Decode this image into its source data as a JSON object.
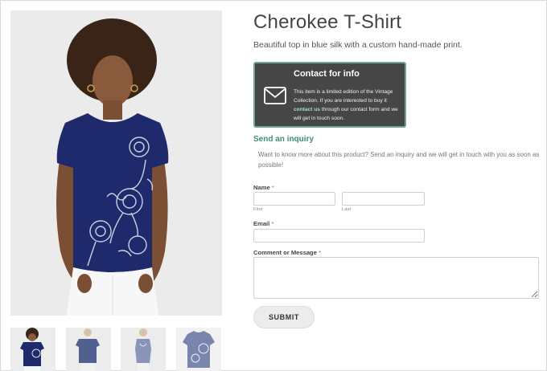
{
  "product": {
    "title": "Cherokee T-Shirt",
    "description": "Beautiful top in blue silk with a custom hand-made print."
  },
  "contact_box": {
    "title": "Contact for info",
    "icon": "envelope-icon",
    "text_before": "This item is a limited edition of the Vintage Collection. If you are interested to buy it",
    "link_text": "contact us",
    "text_after": "through our contact form and we will get in touch soon."
  },
  "inquiry": {
    "title": "Send an inquiry",
    "description": "Want to know more about this product? Send an inquiry and we will get in touch with you as soon as possible!"
  },
  "form": {
    "name_label": "Name",
    "required_mark": "*",
    "first_sublabel": "First",
    "last_sublabel": "Last",
    "email_label": "Email",
    "message_label": "Comment or Message",
    "first_value": "",
    "last_value": "",
    "email_value": "",
    "message_value": "",
    "submit_label": "SUBMIT"
  },
  "gallery": {
    "thumbnails": [
      "front view",
      "front view plain",
      "side view",
      "flat lay"
    ]
  },
  "colors": {
    "accent": "#3f8f72",
    "contact_bg": "#464646",
    "contact_border": "#6fa68a",
    "shirt": "#1e2a6b"
  }
}
